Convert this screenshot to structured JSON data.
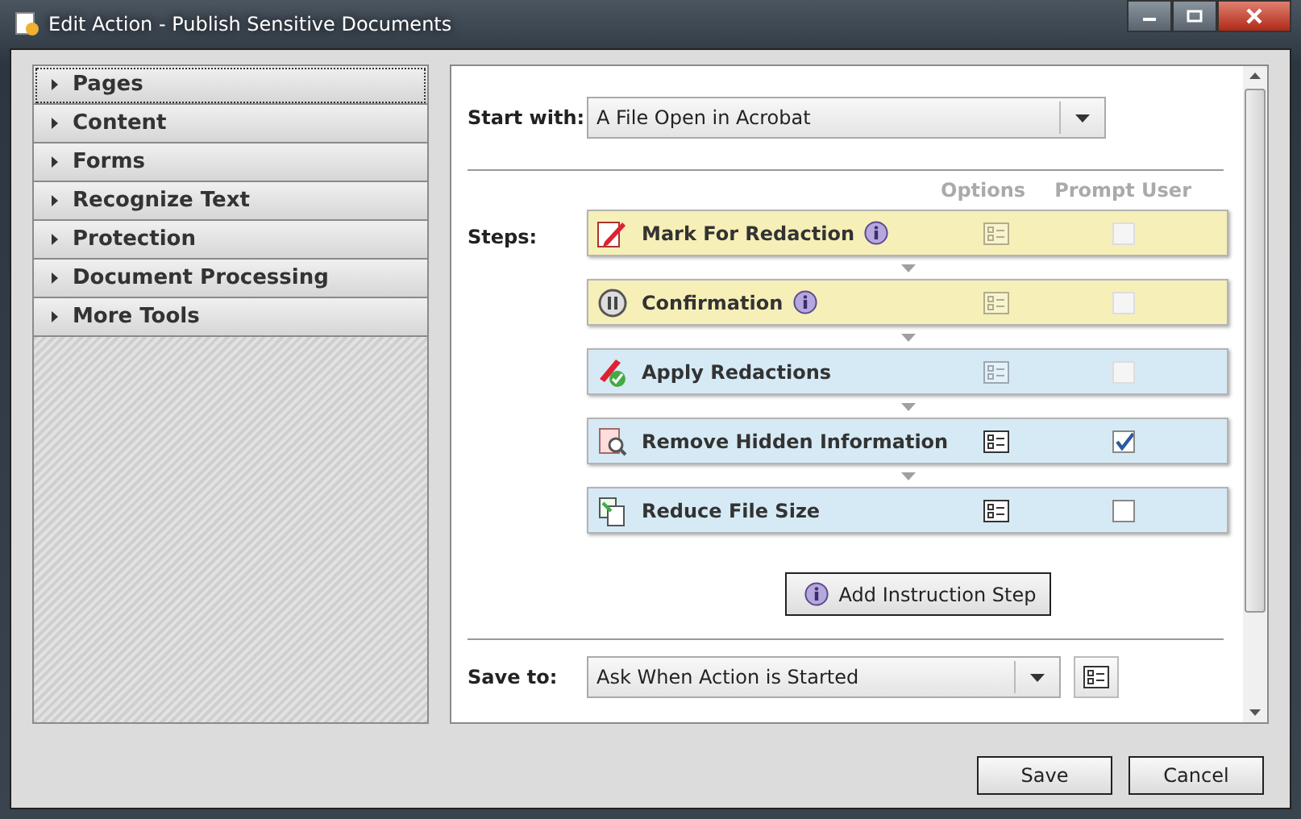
{
  "window": {
    "title": "Edit Action - Publish Sensitive Documents"
  },
  "sidebar": {
    "items": [
      {
        "label": "Pages",
        "selected": true
      },
      {
        "label": "Content",
        "selected": false
      },
      {
        "label": "Forms",
        "selected": false
      },
      {
        "label": "Recognize Text",
        "selected": false
      },
      {
        "label": "Protection",
        "selected": false
      },
      {
        "label": "Document Processing",
        "selected": false
      },
      {
        "label": "More Tools",
        "selected": false
      }
    ]
  },
  "start_with": {
    "label": "Start with:",
    "value": "A File Open in Acrobat"
  },
  "steps": {
    "label": "Steps:",
    "columns": [
      "Options",
      "Prompt User"
    ],
    "items": [
      {
        "kind": "mark",
        "label": "Mark For Redaction",
        "info": true,
        "color": "#f7efb8",
        "disabled": true,
        "checked": false
      },
      {
        "kind": "pause",
        "label": "Confirmation",
        "info": true,
        "color": "#f7efb8",
        "disabled": true,
        "checked": false
      },
      {
        "kind": "apply",
        "label": "Apply Redactions",
        "info": false,
        "color": "#d6eaf5",
        "disabled": true,
        "checked": false
      },
      {
        "kind": "remove",
        "label": "Remove Hidden Information",
        "info": false,
        "color": "#d6eaf5",
        "disabled": false,
        "checked": true
      },
      {
        "kind": "reduce",
        "label": "Reduce File Size",
        "info": false,
        "color": "#d6eaf5",
        "disabled": false,
        "checked": false
      }
    ]
  },
  "add_button": "Add Instruction Step",
  "save_to": {
    "label": "Save to:",
    "value": "Ask When Action is Started"
  },
  "buttons": [
    "Save",
    "Cancel"
  ]
}
